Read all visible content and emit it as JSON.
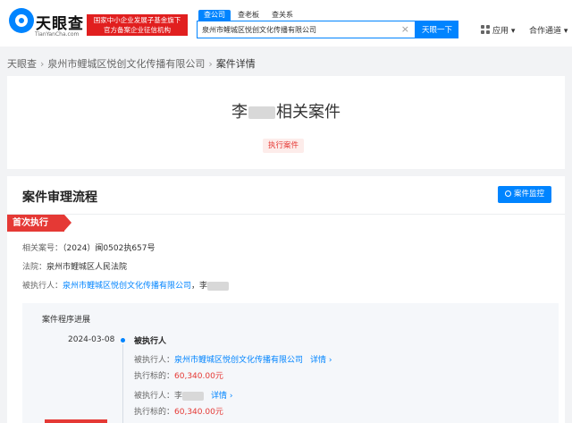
{
  "header": {
    "logo_name": "天眼查",
    "logo_sub": "TianYanCha.com",
    "slogan_line1": "国家中小企业发展子基金旗下",
    "slogan_line2": "官方备案企业征信机构",
    "search_tabs": [
      "查公司",
      "查老板",
      "查关系"
    ],
    "search_value": "泉州市鲤城区悦创文化传播有限公司",
    "search_button": "天眼一下",
    "clear_icon": "close-icon",
    "menu_icon": "grid-icon",
    "apps_label": "应用 ▾",
    "coop_label": "合作通道 ▾"
  },
  "breadcrumb": {
    "home": "天眼查",
    "company": "泉州市鲤城区悦创文化传播有限公司",
    "current": "案件详情",
    "separator": "›"
  },
  "case": {
    "title_prefix": "李",
    "title_suffix": "相关案件",
    "type_tag": "执行案件"
  },
  "process": {
    "title": "案件审理流程",
    "monitor_button": "案件监控",
    "stage_badge": "首次执行",
    "rows": {
      "case_no_label": "相关案号：",
      "case_no": "（2024）闽0502执657号",
      "court_label": "法院：",
      "court": "泉州市鲤城区人民法院",
      "executed_label": "被执行人：",
      "executed_company": "泉州市鲤城区悦创文化传播有限公司",
      "executed_sep": "，李"
    },
    "progress": {
      "title": "案件程序进展",
      "date": "2024-03-08",
      "head": "被执行人",
      "entry1_label": "被执行人：",
      "entry1_company": "泉州市鲤城区悦创文化传播有限公司",
      "entry1_detail": "详情 ›",
      "entry1_amount_label": "执行标的：",
      "entry1_amount": "60,340.00元",
      "entry2_label": "被执行人：",
      "entry2_name": "李",
      "entry2_detail": "详情 ›",
      "entry2_amount_label": "执行标的：",
      "entry2_amount": "60,340.00元"
    }
  },
  "colors": {
    "brand_blue": "#0084ff",
    "accent_red": "#e53935"
  }
}
